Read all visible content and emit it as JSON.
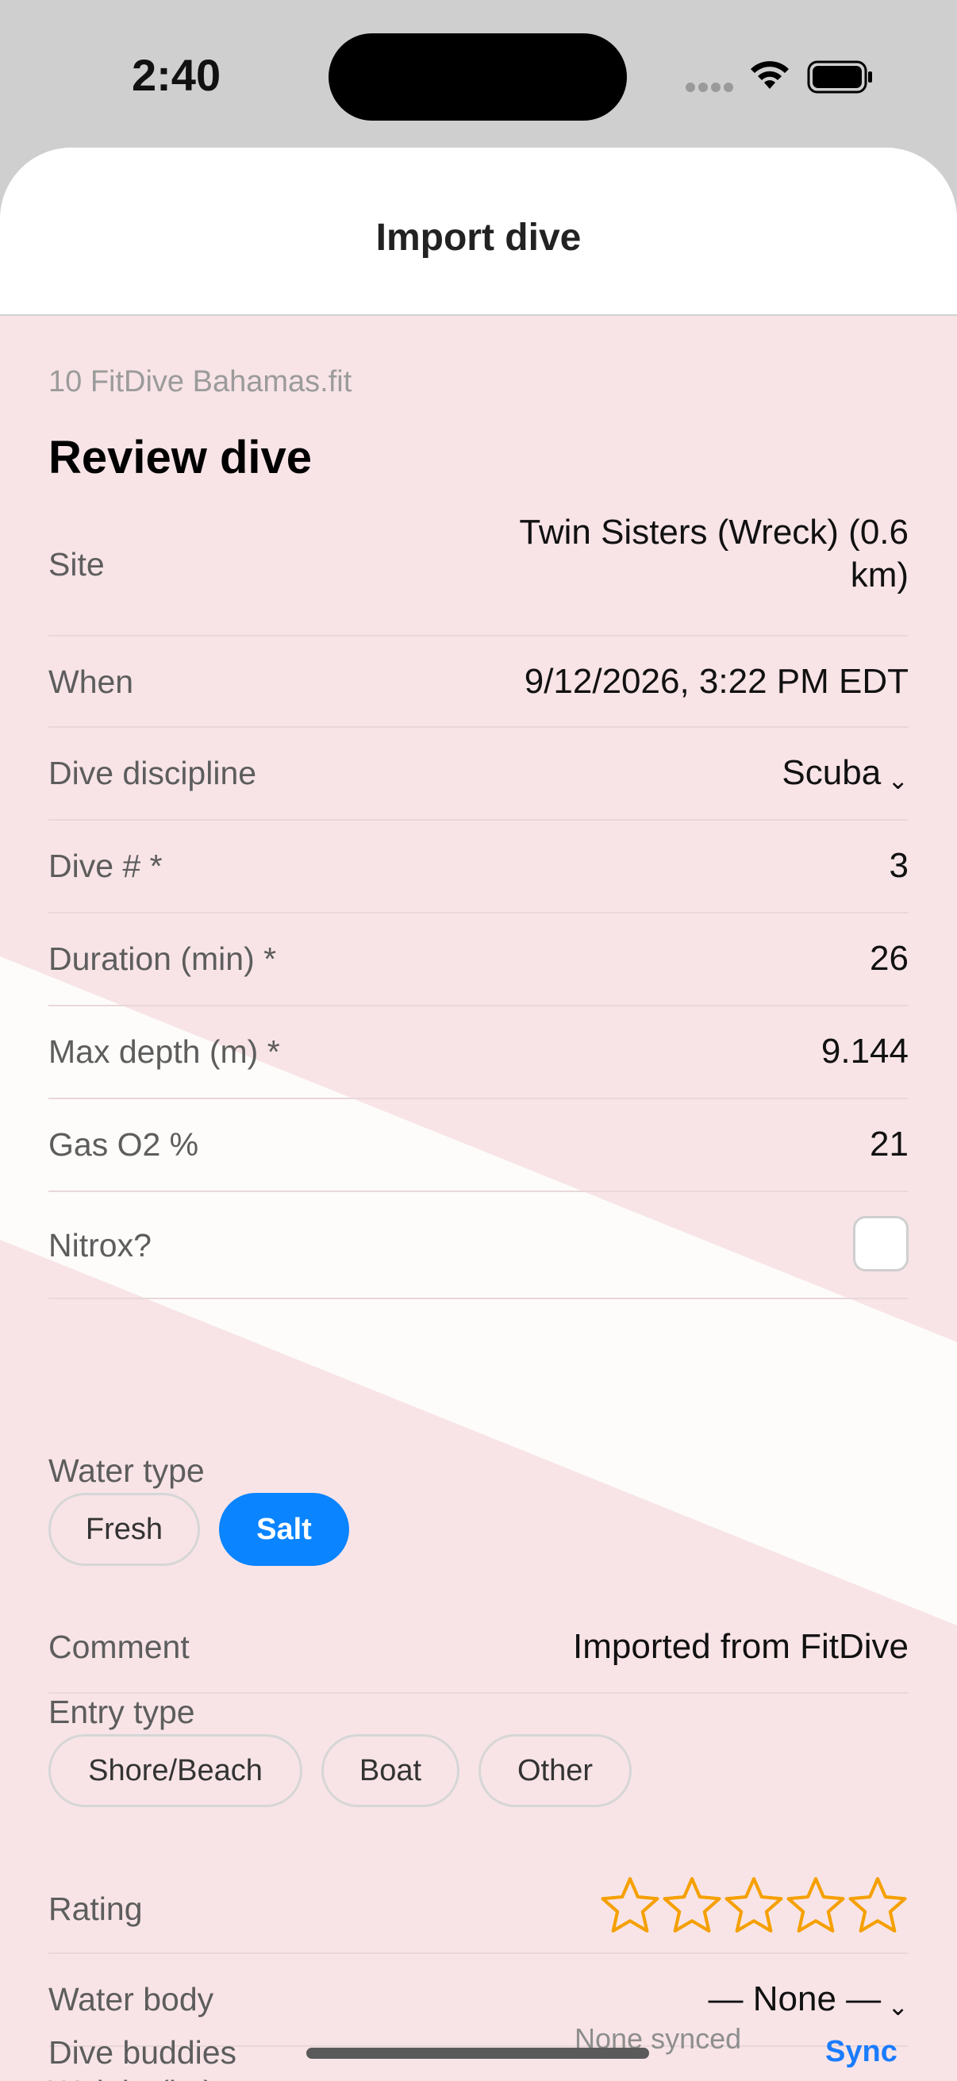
{
  "status": {
    "time": "2:40"
  },
  "sheet": {
    "title": "Import dive"
  },
  "review": {
    "filename": "10 FitDive Bahamas.fit",
    "heading": "Review dive",
    "site_label": "Site",
    "site_value_line1": "Twin Sisters (Wreck) (0.6",
    "site_value_line2": "km)",
    "when_label": "When",
    "when_value": "9/12/2026, 3:22 PM EDT",
    "discipline_label": "Dive discipline",
    "discipline_value": "Scuba",
    "dive_num_label": "Dive # *",
    "dive_num_value": "3",
    "duration_label": "Duration (min) *",
    "duration_value": "26",
    "max_depth_label": "Max depth (m) *",
    "max_depth_value": "9.144",
    "gas_label": "Gas O2 %",
    "gas_value": "21",
    "nitrox_label": "Nitrox?",
    "nitrox_checked": false,
    "water_type_label": "Water type",
    "water_type_options": [
      "Fresh",
      "Salt"
    ],
    "water_type_selected": "Salt",
    "comment_label": "Comment",
    "comment_value": "Imported from FitDive",
    "entry_type_label": "Entry type",
    "entry_type_options": [
      "Shore/Beach",
      "Boat",
      "Other"
    ],
    "rating_label": "Rating",
    "rating_value": 0,
    "rating_max": 5,
    "water_body_label": "Water body",
    "water_body_value": "— None —",
    "weight_label": "Weight (kg)",
    "buddies_label": "Dive buddies",
    "buddies_status": "None synced",
    "sync_label": "Sync"
  },
  "colors": {
    "accent": "#0a84ff",
    "star": "#f5a000",
    "background": "#f8e4e7"
  }
}
